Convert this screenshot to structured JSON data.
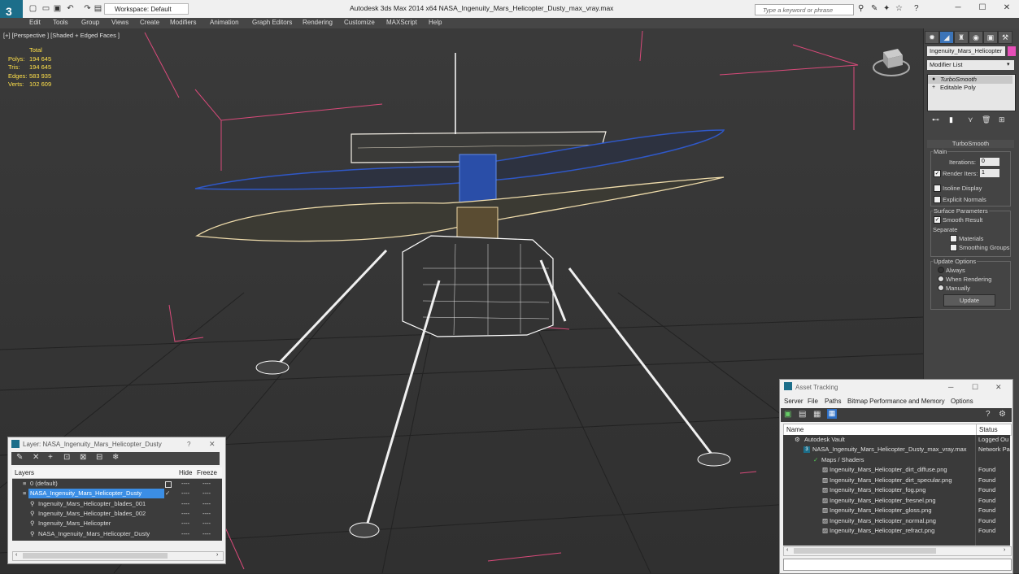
{
  "titlebar": {
    "app_title": "Autodesk 3ds Max  2014 x64      NASA_Ingenuity_Mars_Helicopter_Dusty_max_vray.max",
    "workspace": "Workspace: Default",
    "search_placeholder": "Type a keyword or phrase",
    "help": "?"
  },
  "menu": [
    "Edit",
    "Tools",
    "Group",
    "Views",
    "Create",
    "Modifiers",
    "Animation",
    "Graph Editors",
    "Rendering",
    "Customize",
    "MAXScript",
    "Help"
  ],
  "viewport": {
    "label": "[+] [Perspective ] [Shaded + Edged Faces ]",
    "stats": {
      "header": "Total",
      "rows": [
        {
          "label": "Polys:",
          "value": "194 645"
        },
        {
          "label": "Tris:",
          "value": "194 645"
        },
        {
          "label": "Edges:",
          "value": "583 935"
        },
        {
          "label": "Verts:",
          "value": "102 609"
        }
      ]
    }
  },
  "command_panel": {
    "object_name": "Ingenuity_Mars_Helicopter",
    "object_color": "#e64fb8",
    "modifier_list": "Modifier List",
    "stack": [
      "TurboSmooth",
      "Editable Poly"
    ],
    "turbosmooth": {
      "title": "TurboSmooth",
      "main": "Main",
      "iterations_label": "Iterations:",
      "iterations": "0",
      "render_iters_label": "Render Iters:",
      "render_iters": "1",
      "isoline": "Isoline Display",
      "explicit_normals": "Explicit Normals",
      "surface_params": "Surface Parameters",
      "smooth_result": "Smooth Result",
      "separate": "Separate",
      "materials": "Materials",
      "smoothing_groups": "Smoothing Groups",
      "update_options": "Update Options",
      "always": "Always",
      "when_rendering": "When Rendering",
      "manually": "Manually",
      "update_button": "Update"
    }
  },
  "layer_window": {
    "title": "Layer: NASA_Ingenuity_Mars_Helicopter_Dusty",
    "help": "?",
    "columns": [
      "Layers",
      "Hide",
      "Freeze"
    ],
    "rows": [
      {
        "name": "0 (default)",
        "indent": 0,
        "selected": false
      },
      {
        "name": "NASA_Ingenuity_Mars_Helicopter_Dusty",
        "indent": 0,
        "selected": true
      },
      {
        "name": "Ingenuity_Mars_Helicopter_blades_001",
        "indent": 1,
        "selected": false
      },
      {
        "name": "Ingenuity_Mars_Helicopter_blades_002",
        "indent": 1,
        "selected": false
      },
      {
        "name": "Ingenuity_Mars_Helicopter",
        "indent": 1,
        "selected": false
      },
      {
        "name": "NASA_Ingenuity_Mars_Helicopter_Dusty",
        "indent": 1,
        "selected": false
      }
    ],
    "dashes": "----"
  },
  "asset_window": {
    "title": "Asset Tracking",
    "menu": [
      "Server",
      "File",
      "Paths",
      "Bitmap Performance and Memory",
      "Options"
    ],
    "columns": [
      "Name",
      "Status"
    ],
    "rows": [
      {
        "name": "Autodesk Vault",
        "status": "Logged Ou",
        "indent": 1
      },
      {
        "name": "NASA_Ingenuity_Mars_Helicopter_Dusty_max_vray.max",
        "status": "Network Pa",
        "indent": 2
      },
      {
        "name": "Maps / Shaders",
        "status": "",
        "indent": 3
      },
      {
        "name": "Ingenuity_Mars_Helicopter_dirt_diffuse.png",
        "status": "Found",
        "indent": 4
      },
      {
        "name": "Ingenuity_Mars_Helicopter_dirt_specular.png",
        "status": "Found",
        "indent": 4
      },
      {
        "name": "Ingenuity_Mars_Helicopter_fog.png",
        "status": "Found",
        "indent": 4
      },
      {
        "name": "Ingenuity_Mars_Helicopter_fresnel.png",
        "status": "Found",
        "indent": 4
      },
      {
        "name": "Ingenuity_Mars_Helicopter_gloss.png",
        "status": "Found",
        "indent": 4
      },
      {
        "name": "Ingenuity_Mars_Helicopter_normal.png",
        "status": "Found",
        "indent": 4
      },
      {
        "name": "Ingenuity_Mars_Helicopter_refract.png",
        "status": "Found",
        "indent": 4
      }
    ]
  }
}
